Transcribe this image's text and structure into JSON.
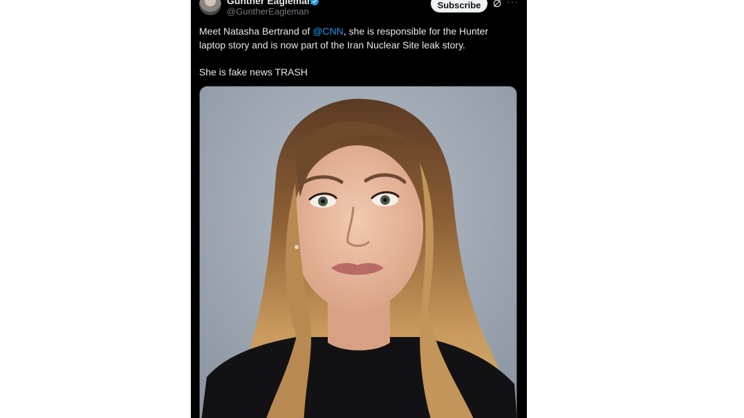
{
  "author": {
    "display_name": "Gunther Eagleman",
    "handle": "@GuntherEagleman",
    "avatar_icon": "user-avatar",
    "verified_icon": "verified-badge-icon",
    "verified_color": "#1d9bf0"
  },
  "actions": {
    "subscribe_label": "Subscribe",
    "grok_icon": "grok-icon",
    "more_icon": "more-horizontal-icon",
    "more_glyph": "···"
  },
  "tweet": {
    "line1_before": "Meet Natasha Bertrand of ",
    "mention": "@CNN",
    "line1_after": ", she is responsible for the Hunter laptop story and is now part of the Iran Nuclear Site leak story.",
    "line2": "She is fake news TRASH",
    "mention_color": "#1d9bf0"
  },
  "media": {
    "alt": "Portrait photo of a woman with long wavy blonde-brown hair wearing a black top against a grey background"
  },
  "colors": {
    "background": "#000000",
    "text": "#e7e9ea",
    "secondary_text": "#71767b",
    "accent": "#1d9bf0"
  }
}
